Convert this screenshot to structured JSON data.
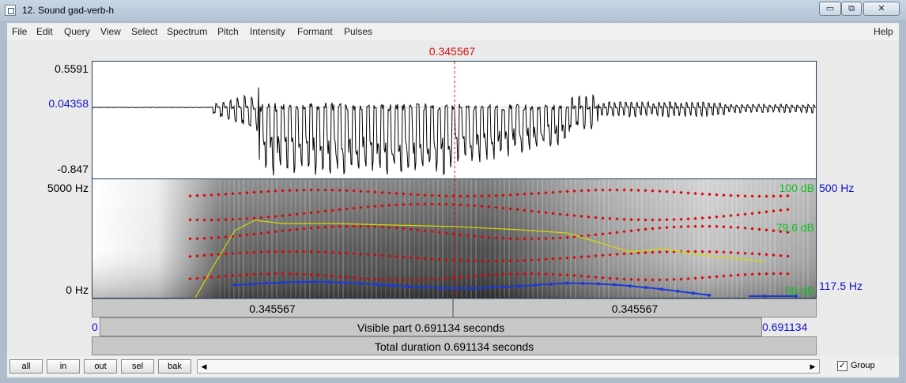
{
  "window": {
    "title": "12. Sound gad-verb-h"
  },
  "title_buttons": {
    "minimize": "▭",
    "maximize": "⧉",
    "close": "✕"
  },
  "menu": [
    "File",
    "Edit",
    "Query",
    "View",
    "Select",
    "Spectrum",
    "Pitch",
    "Intensity",
    "Formant",
    "Pulses"
  ],
  "help": "Help",
  "cursor": {
    "time_label": "0.345567",
    "time_fraction": 0.5
  },
  "waveform": {
    "max_label": "0.5591",
    "cursor_value_label": "0.04358",
    "min_label": "-0.847"
  },
  "spectrogram": {
    "freq_top_label": "5000 Hz",
    "freq_bottom_label": "0 Hz",
    "intensity_top_label": "100 dB",
    "intensity_mid_label": "79.6 dB",
    "intensity_bottom_label": "50 dB",
    "pitch_top_label": "500 Hz",
    "pitch_cursor_label": "117.5 Hz"
  },
  "selection": {
    "left_label": "0.345567",
    "right_label": "0.345567"
  },
  "visible": {
    "start_label": "0",
    "text": "Visible part 0.691134 seconds",
    "end_label": "0.691134"
  },
  "total": {
    "text": "Total duration 0.691134 seconds"
  },
  "buttons": [
    "all",
    "in",
    "out",
    "sel",
    "bak"
  ],
  "group": {
    "label": "Group",
    "checked": true
  },
  "colors": {
    "cursor": "#d11010",
    "value_blue": "#1010c8",
    "intensity_green": "#10c020",
    "formant_red": "#e00000",
    "pitch_blue": "#1a3ad8",
    "intensity_yellow": "#d8d800"
  }
}
